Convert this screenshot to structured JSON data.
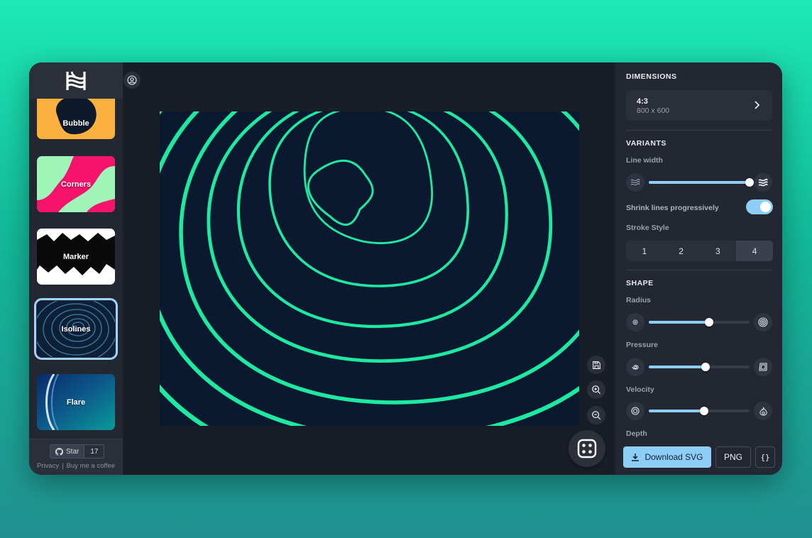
{
  "sidebar": {
    "cards": [
      {
        "label": "Bubble"
      },
      {
        "label": "Corners"
      },
      {
        "label": "Marker"
      },
      {
        "label": "Isolines"
      },
      {
        "label": "Flare"
      }
    ],
    "selected": "Isolines",
    "github": {
      "star_label": "Star",
      "star_count": "17"
    },
    "links": {
      "privacy": "Privacy",
      "separator": "|",
      "coffee": "Buy me a coffee"
    }
  },
  "panel": {
    "dimensions": {
      "title": "DIMENSIONS",
      "ratio": "4:3",
      "size": "800 x 600"
    },
    "variants": {
      "title": "VARIANTS",
      "line_width_label": "Line width",
      "line_width": 1.0,
      "shrink_label": "Shrink lines progressively",
      "shrink_on": true,
      "stroke_style_label": "Stroke Style",
      "stroke_styles": [
        "1",
        "2",
        "3",
        "4"
      ],
      "stroke_style_selected": "4"
    },
    "shape": {
      "title": "SHAPE",
      "radius_label": "Radius",
      "radius": 0.6,
      "pressure_label": "Pressure",
      "pressure": 0.56,
      "velocity_label": "Velocity",
      "velocity": 0.55,
      "depth_label": "Depth"
    },
    "actions": {
      "download_svg": "Download SVG",
      "png": "PNG",
      "code": "{}"
    }
  },
  "colors": {
    "accent": "#8ecdf5",
    "line_color": "#1de9a0",
    "artboard_bg": "#0a1930"
  }
}
